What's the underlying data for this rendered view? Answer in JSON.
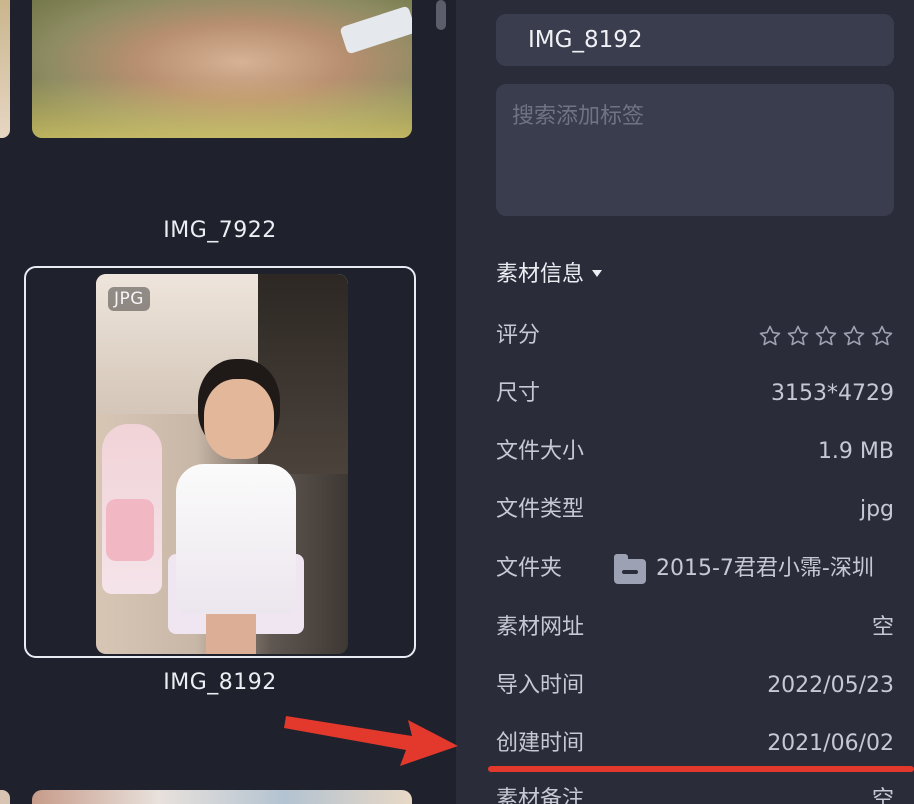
{
  "gallery": {
    "items": [
      {
        "name": "IMG_7922"
      },
      {
        "name": "IMG_8192",
        "format_badge": "JPG",
        "selected": true
      }
    ]
  },
  "inspector": {
    "name_value": "IMG_8192",
    "tag_placeholder": "搜索添加标签",
    "section_title": "素材信息",
    "fields": {
      "rating": {
        "label": "评分",
        "value": 0,
        "max": 5
      },
      "dimensions": {
        "label": "尺寸",
        "value": "3153*4729"
      },
      "file_size": {
        "label": "文件大小",
        "value": "1.9 MB"
      },
      "file_type": {
        "label": "文件类型",
        "value": "jpg"
      },
      "folder": {
        "label": "文件夹",
        "value": "2015-7君君小霈-深圳"
      },
      "source_url": {
        "label": "素材网址",
        "value": "空"
      },
      "import_time": {
        "label": "导入时间",
        "value": "2022/05/23"
      },
      "created_time": {
        "label": "创建时间",
        "value": "2021/06/02"
      },
      "notes": {
        "label": "素材备注",
        "value": "空"
      }
    }
  },
  "colors": {
    "annotation": "#e2392c",
    "panel_bg": "#2a2c39",
    "field_bg": "#3a3d4d"
  }
}
